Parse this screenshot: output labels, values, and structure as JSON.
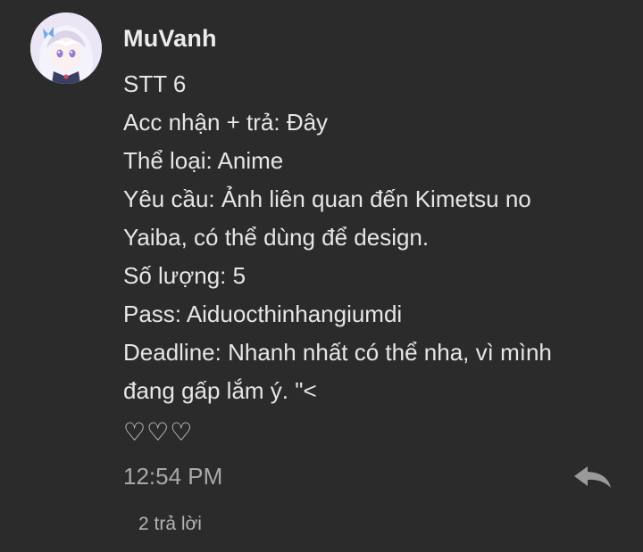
{
  "comment": {
    "author": "MuVanh",
    "lines": [
      "STT 6",
      "Acc nhận + trả: Đây",
      "Thể loại: Anime",
      "Yêu cầu: Ảnh liên quan đến Kimetsu no",
      "Yaiba, có thể dùng để design.",
      "Số lượng: 5",
      "Pass: Aiduocthinhangiumdi",
      "Deadline: Nhanh nhất có thể nha, vì mình",
      "đang gấp lắm ý. \"<"
    ],
    "hearts": "♡♡♡",
    "timestamp": "12:54 PM",
    "reply_count": "2 trả lời",
    "icons": {
      "avatar": "avatar-image",
      "reply": "reply-arrow-icon"
    }
  },
  "colors": {
    "background": "#2b2b2b",
    "text": "#e6e6e6",
    "muted": "#a9a9a9"
  }
}
